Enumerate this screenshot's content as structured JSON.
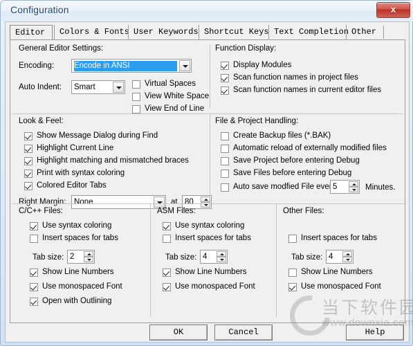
{
  "window": {
    "title": "Configuration",
    "close_label": "✕",
    "close_glyph": "x"
  },
  "tabs": [
    {
      "label": "Editor",
      "active": true
    },
    {
      "label": "Colors & Fonts",
      "active": false
    },
    {
      "label": "User Keywords",
      "active": false
    },
    {
      "label": "Shortcut Keys",
      "active": false
    },
    {
      "label": "Text Completion",
      "active": false
    },
    {
      "label": "Other",
      "active": false
    }
  ],
  "general_editor": {
    "title": "General Editor Settings:",
    "encoding_label": "Encoding:",
    "encoding_value": "Encode in ANSI",
    "auto_indent_label": "Auto Indent:",
    "auto_indent_value": "Smart",
    "checks": [
      {
        "label": "Virtual Spaces",
        "checked": false
      },
      {
        "label": "View White Space",
        "checked": false
      },
      {
        "label": "View End of Line",
        "checked": false
      }
    ]
  },
  "function_display": {
    "title": "Function Display:",
    "checks": [
      {
        "label": "Display Modules",
        "checked": true
      },
      {
        "label": "Scan function names in project files",
        "checked": true
      },
      {
        "label": "Scan function names in current editor files",
        "checked": true
      }
    ]
  },
  "look_feel": {
    "title": "Look & Feel:",
    "checks": [
      {
        "label": "Show Message Dialog during Find",
        "checked": true
      },
      {
        "label": "Highlight Current Line",
        "checked": true
      },
      {
        "label": "Highlight matching and mismatched braces",
        "checked": true
      },
      {
        "label": "Print with syntax coloring",
        "checked": true
      },
      {
        "label": "Colored Editor Tabs",
        "checked": true
      }
    ],
    "right_margin_label": "Right Margin:",
    "right_margin_value": "None",
    "at_label": "at",
    "at_value": "80"
  },
  "file_project": {
    "title": "File & Project Handling:",
    "checks": [
      {
        "label": "Create Backup files (*.BAK)",
        "checked": false
      },
      {
        "label": "Automatic reload of externally modified files",
        "checked": false
      },
      {
        "label": "Save Project before entering Debug",
        "checked": false
      },
      {
        "label": "Save Files before entering Debug",
        "checked": false
      }
    ],
    "autosave_label": "Auto save modfied File every",
    "autosave_checked": false,
    "autosave_value": "5",
    "autosave_suffix": "Minutes."
  },
  "cpp_files": {
    "title": "C/C++ Files:",
    "checks_top": [
      {
        "label": "Use syntax coloring",
        "checked": true
      },
      {
        "label": "Insert spaces for tabs",
        "checked": false
      }
    ],
    "tab_size_label": "Tab size:",
    "tab_size_value": "2",
    "checks_bottom": [
      {
        "label": "Show Line Numbers",
        "checked": true
      },
      {
        "label": "Use monospaced Font",
        "checked": true
      },
      {
        "label": "Open with Outlining",
        "checked": true
      }
    ]
  },
  "asm_files": {
    "title": "ASM Files:",
    "checks_top": [
      {
        "label": "Use syntax coloring",
        "checked": true
      },
      {
        "label": "Insert spaces for tabs",
        "checked": false
      }
    ],
    "tab_size_label": "Tab size:",
    "tab_size_value": "4",
    "checks_bottom": [
      {
        "label": "Show Line Numbers",
        "checked": true
      },
      {
        "label": "Use monospaced Font",
        "checked": true
      }
    ]
  },
  "other_files": {
    "title": "Other Files:",
    "checks_top": [
      {
        "label": "Insert spaces for tabs",
        "checked": false
      }
    ],
    "tab_size_label": "Tab size:",
    "tab_size_value": "4",
    "checks_bottom": [
      {
        "label": "Show Line Numbers",
        "checked": false
      },
      {
        "label": "Use monospaced Font",
        "checked": true
      }
    ]
  },
  "buttons": {
    "ok": "OK",
    "cancel": "Cancel",
    "help": "Help"
  },
  "watermark": {
    "cn_text": "当下软件园",
    "url_text": "www.downxia.com"
  },
  "colors": {
    "selection_blue": "#2c9ef0",
    "close_red": "#bc3124",
    "dialog_bg": "#f0f0f0",
    "frame_blue": "#9fb6cd"
  }
}
